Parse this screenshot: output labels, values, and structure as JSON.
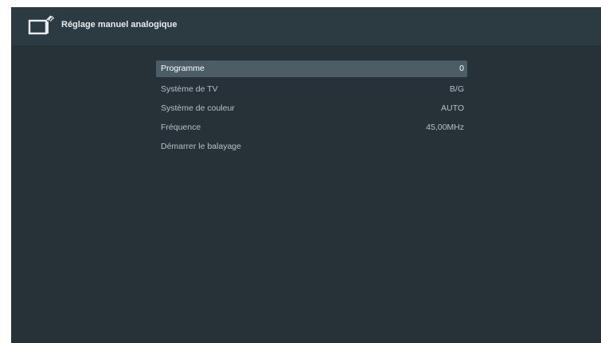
{
  "header": {
    "title": "Réglage manuel analogique",
    "icon": "tv-settings-icon"
  },
  "menu": {
    "items": [
      {
        "label": "Programme",
        "value": "0",
        "selected": true
      },
      {
        "label": "Système de TV",
        "value": "B/G",
        "selected": false
      },
      {
        "label": "Système de couleur",
        "value": "AUTO",
        "selected": false
      },
      {
        "label": "Fréquence",
        "value": "45,00MHz",
        "selected": false
      },
      {
        "label": "Démarrer le balayage",
        "value": "",
        "selected": false
      }
    ]
  },
  "colors": {
    "background": "#263238",
    "header": "#2c3a41",
    "selected_row": "#4d5d66",
    "text": "#b7c0c4",
    "selected_text": "#ffffff"
  }
}
